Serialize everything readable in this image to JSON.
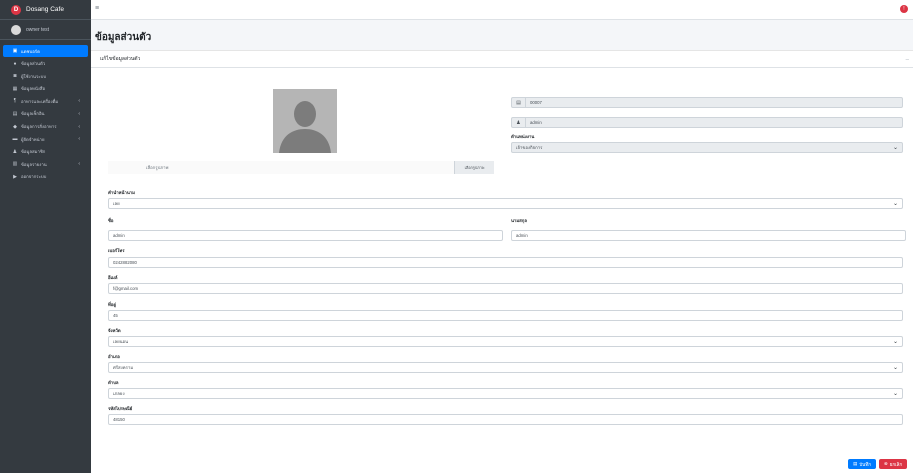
{
  "brand": {
    "name": "Dosang Cafe",
    "logo": "D"
  },
  "user": {
    "name": "owner test"
  },
  "sidebar": {
    "items": [
      {
        "icon": "dashboard-icon",
        "glyph": "▣",
        "label": "แดชบอร์ด",
        "arrow": "",
        "active": true
      },
      {
        "icon": "user-circle-icon",
        "glyph": "●",
        "label": "ข้อมูลส่วนตัว",
        "arrow": ""
      },
      {
        "icon": "users-icon",
        "glyph": "◙",
        "label": "ผู้ใช้งานระบบ",
        "arrow": ""
      },
      {
        "icon": "table-icon",
        "glyph": "▦",
        "label": "ข้อมูลหนังสือ",
        "arrow": ""
      },
      {
        "icon": "food-icon",
        "glyph": "¶",
        "label": "อาหารและเครื่องดื่ม",
        "arrow": "‹"
      },
      {
        "icon": "list-icon",
        "glyph": "▤",
        "label": "ข้อมูลเช็กอิน",
        "arrow": "‹"
      },
      {
        "icon": "bag-icon",
        "glyph": "◆",
        "label": "ข้อมูลการสั่งอาหาร",
        "arrow": "‹"
      },
      {
        "icon": "truck-icon",
        "glyph": "▬",
        "label": "ผู้จัดจำหน่าย",
        "arrow": "‹"
      },
      {
        "icon": "person-icon",
        "glyph": "♟",
        "label": "ข้อมูลสมาชิก",
        "arrow": ""
      },
      {
        "icon": "chart-icon",
        "glyph": "▥",
        "label": "ข้อมูลรายงาน",
        "arrow": "‹"
      },
      {
        "icon": "logout-icon",
        "glyph": "▶",
        "label": "ออกจากระบบ",
        "arrow": ""
      }
    ]
  },
  "topbar": {
    "menu_icon": "≡",
    "notif_icon": "!"
  },
  "page": {
    "title": "ข้อมูลส่วนตัว"
  },
  "card": {
    "title": "แก้ไขข้อมูลส่วนตัว",
    "tool": "–"
  },
  "photo": {
    "file_placeholder": "เลือกรูปภาพ",
    "browse_label": "เลือกรูปภาพ"
  },
  "form": {
    "member_id": {
      "icon": "▤",
      "value": "00007"
    },
    "username": {
      "icon": "♟",
      "value": "admin"
    },
    "position": {
      "label": "ตำแหน่งงาน",
      "value": "เจ้าของกิจการ"
    },
    "prefix": {
      "label": "คำนำหน้านาม",
      "value": "เลย"
    },
    "first_name": {
      "label": "ชื่อ",
      "value": "admin"
    },
    "last_name": {
      "label": "นามสกุล",
      "value": "admin"
    },
    "phone": {
      "label": "เบอร์โทร",
      "value": "0242882080"
    },
    "email": {
      "label": "อีเมล์",
      "value": "f@gmail.com"
    },
    "address": {
      "label": "ที่อยู่",
      "value": "45"
    },
    "province": {
      "label": "จังหวัด",
      "value": "เลยนอน"
    },
    "district": {
      "label": "อำเภอ",
      "value": "ศรีสงคราม"
    },
    "subdistrict": {
      "label": "ตำบล",
      "value": "เภลยง"
    },
    "postcode": {
      "label": "รหัสไปรษณีย์",
      "value": "48150"
    }
  },
  "actions": {
    "save": "บันทึก",
    "save_icon": "▤",
    "cancel": "ยกเลิก",
    "cancel_icon": "⊗"
  }
}
